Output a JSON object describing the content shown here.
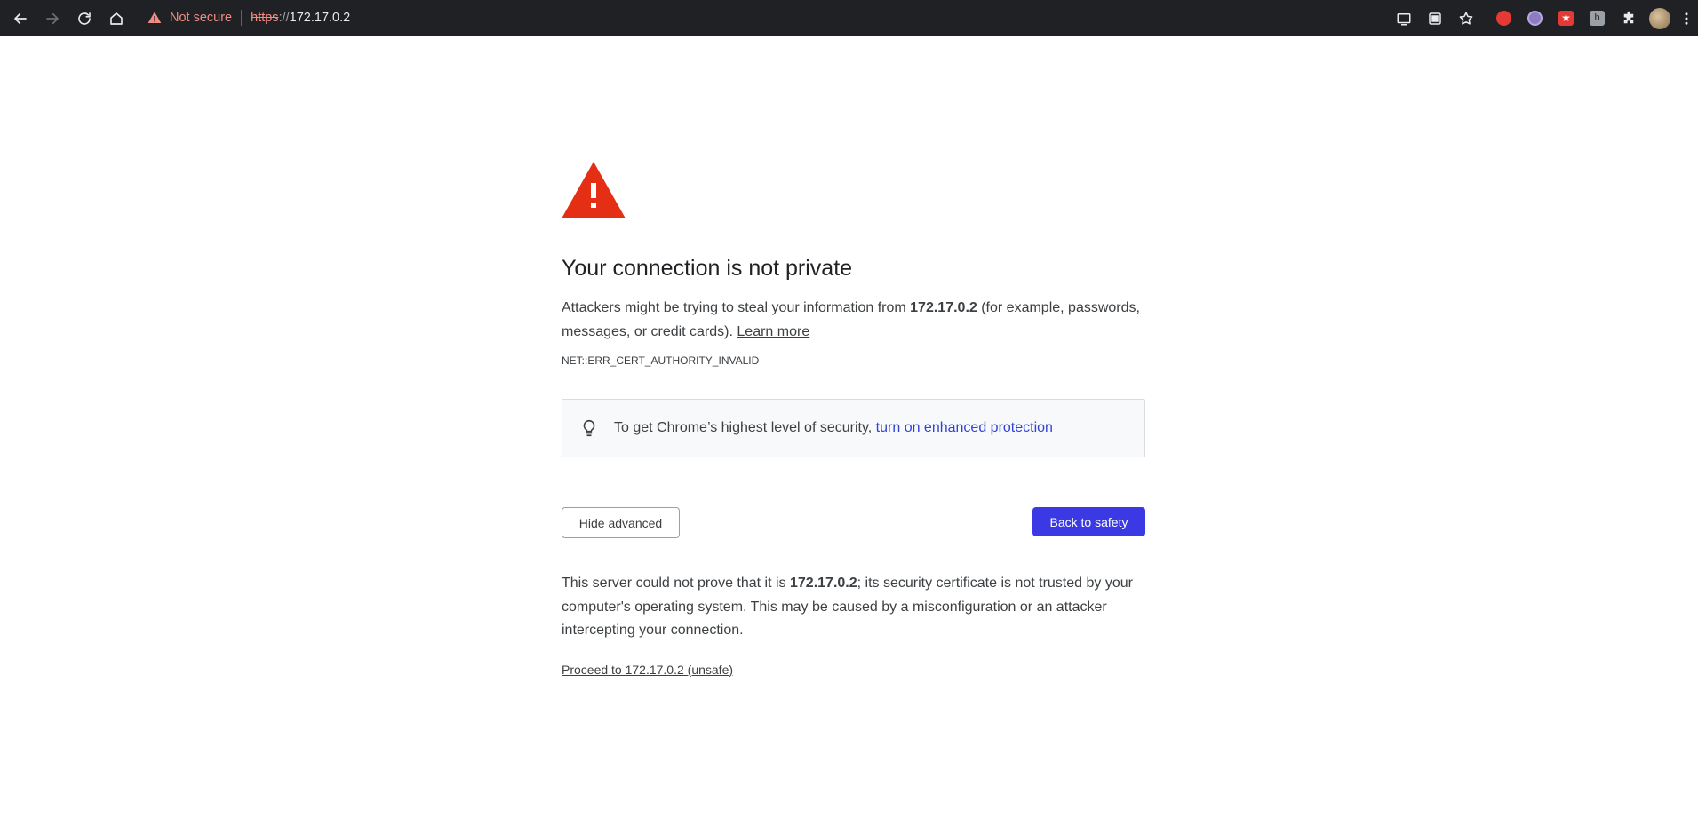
{
  "browser": {
    "security_label": "Not secure",
    "url_scheme": "https",
    "url_separator": "://",
    "url_host": "172.17.0.2"
  },
  "interstitial": {
    "title": "Your connection is not private",
    "msg_prefix": "Attackers might be trying to steal your information from ",
    "msg_host": "172.17.0.2",
    "msg_suffix": " (for example, passwords, messages, or credit cards). ",
    "learn_more": "Learn more",
    "error_code": "NET::ERR_CERT_AUTHORITY_INVALID",
    "enhanced_prefix": "To get Chrome’s highest level of security, ",
    "enhanced_link": "turn on enhanced protection",
    "hide_advanced": "Hide advanced",
    "back_to_safety": "Back to safety",
    "details_prefix": "This server could not prove that it is ",
    "details_host": "172.17.0.2",
    "details_suffix": "; its security certificate is not trusted by your computer's operating system. This may be caused by a misconfiguration or an attacker intercepting your connection.",
    "proceed": "Proceed to 172.17.0.2 (unsafe)"
  },
  "icons": {
    "back": "arrow-left-icon",
    "forward": "arrow-right-icon",
    "reload": "reload-icon",
    "home": "home-icon",
    "warning": "warning-triangle-icon",
    "cast": "cast-icon",
    "apps": "apps-icon",
    "bookmark": "star-icon",
    "extensions": "puzzle-icon",
    "menu": "kebab-menu-icon",
    "bulb": "lightbulb-icon"
  },
  "colors": {
    "toolbar_bg": "#202124",
    "danger": "#f28b82",
    "warning_red": "#e52f14",
    "primary_button": "#3b39e3",
    "link": "#3143d6"
  }
}
